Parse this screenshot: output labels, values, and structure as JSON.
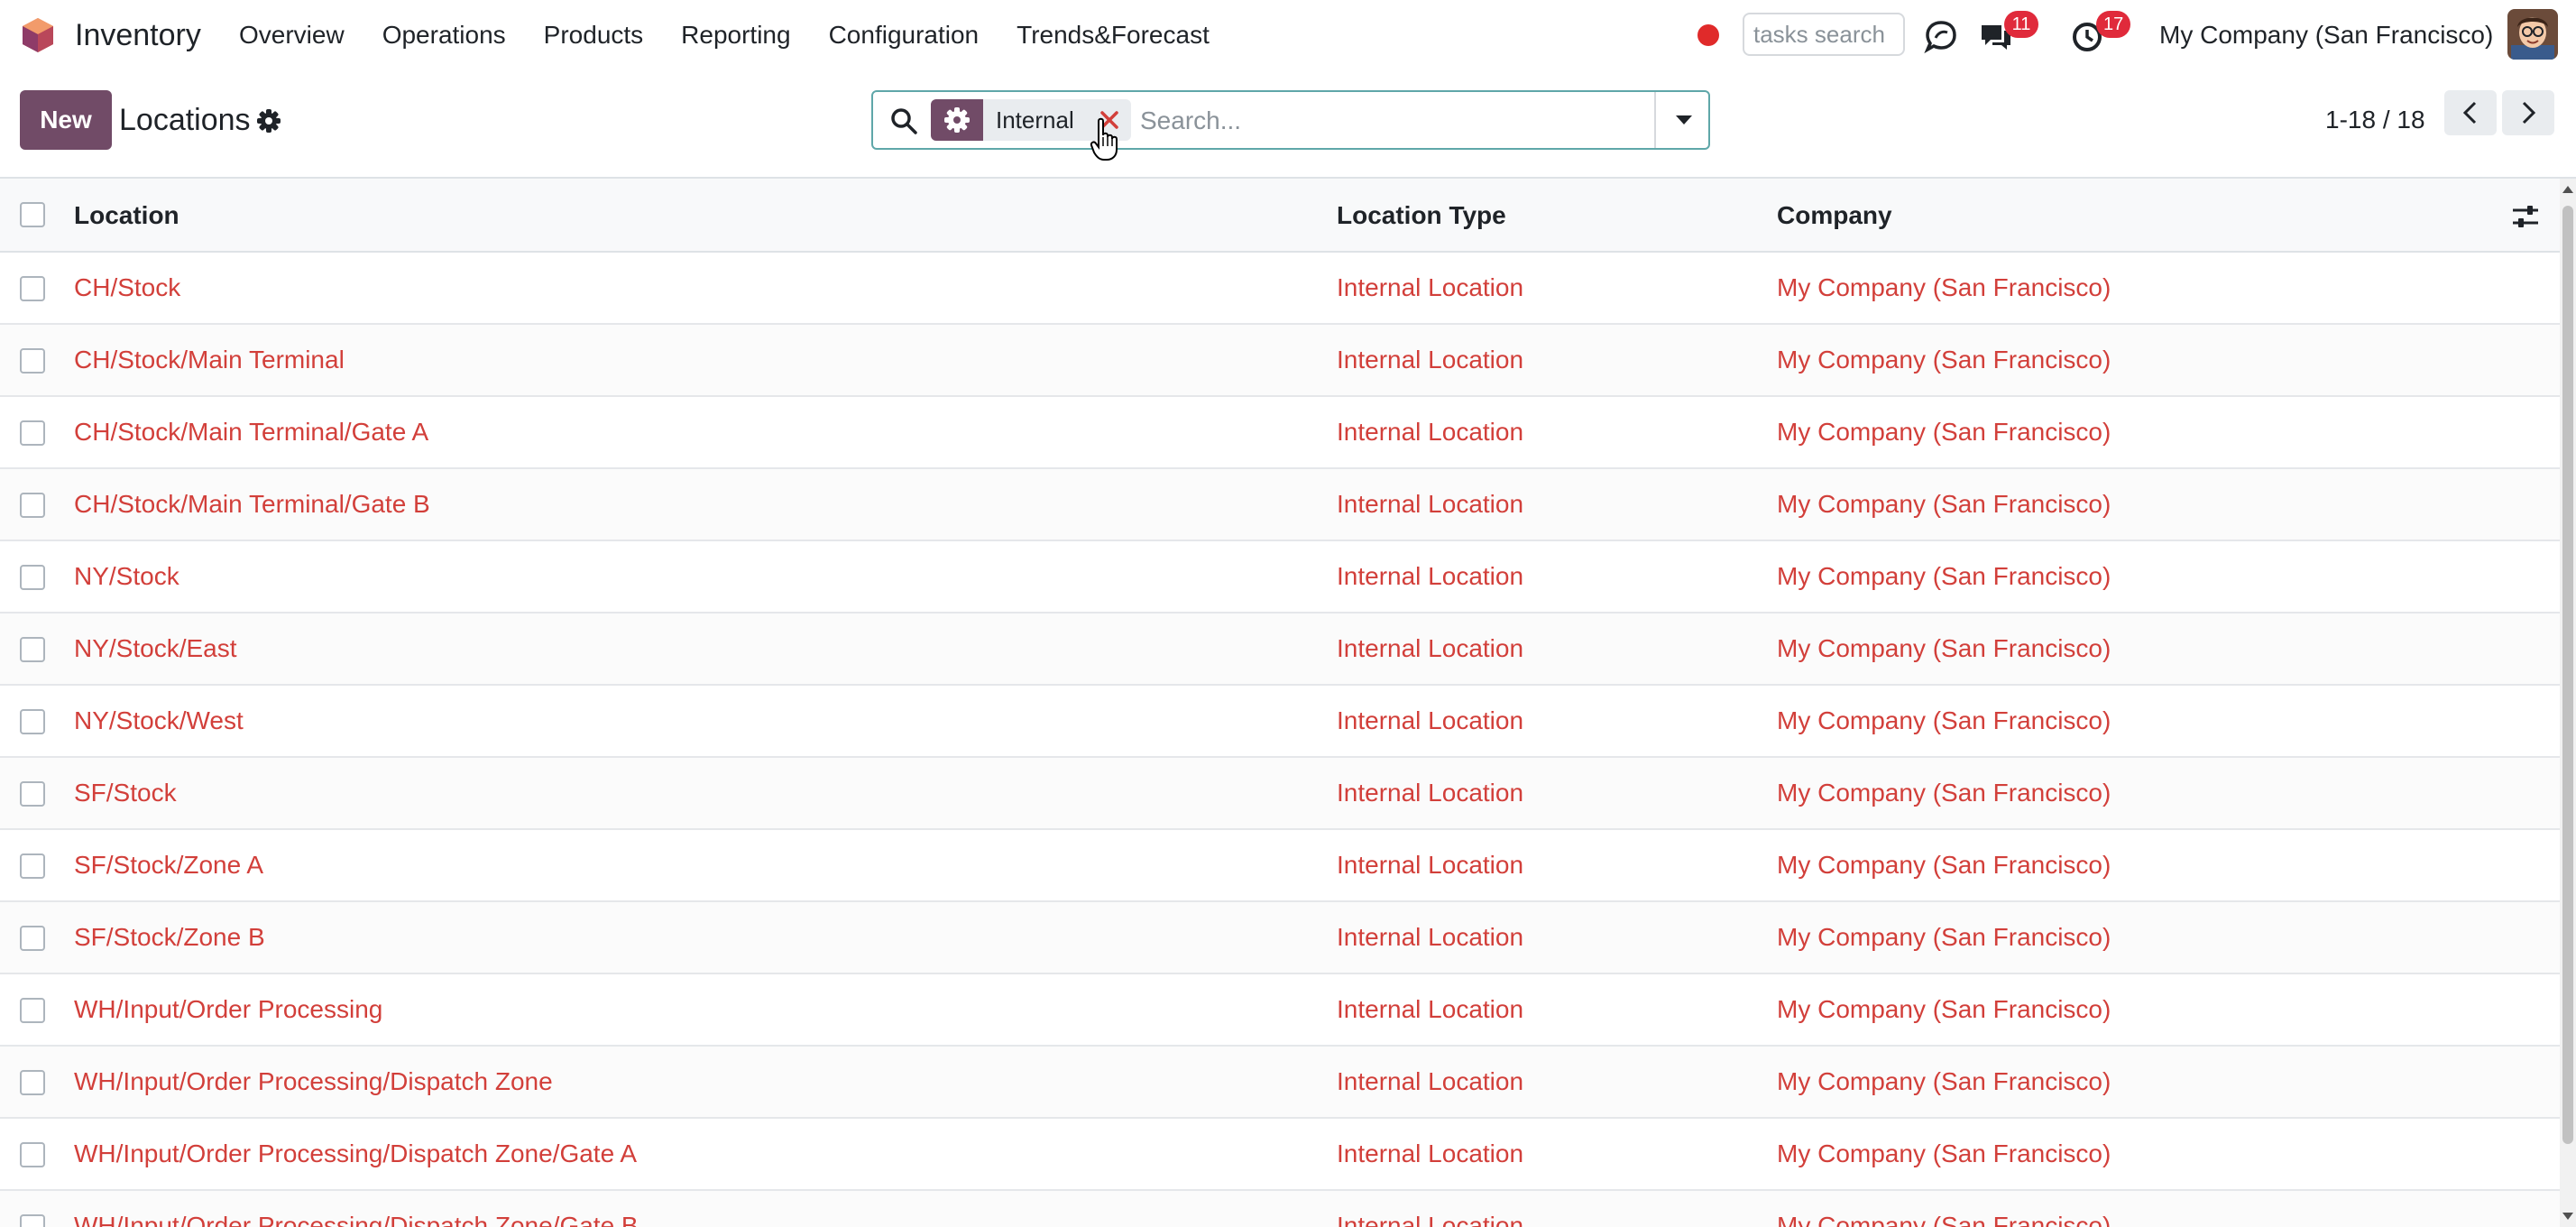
{
  "navbar": {
    "app_name": "Inventory",
    "menu": [
      "Overview",
      "Operations",
      "Products",
      "Reporting",
      "Configuration",
      "Trends&Forecast"
    ],
    "tasks_search_placeholder": "tasks search",
    "messages_badge": "11",
    "activities_badge": "17",
    "company": "My Company (San Francisco)"
  },
  "control_panel": {
    "new_label": "New",
    "title": "Locations",
    "search": {
      "facet_label": "Internal",
      "placeholder": "Search..."
    },
    "pager": "1-18 / 18"
  },
  "list": {
    "columns": [
      "Location",
      "Location Type",
      "Company"
    ],
    "rows": [
      {
        "location": "CH/Stock",
        "type": "Internal Location",
        "company": "My Company (San Francisco)"
      },
      {
        "location": "CH/Stock/Main Terminal",
        "type": "Internal Location",
        "company": "My Company (San Francisco)"
      },
      {
        "location": "CH/Stock/Main Terminal/Gate A",
        "type": "Internal Location",
        "company": "My Company (San Francisco)"
      },
      {
        "location": "CH/Stock/Main Terminal/Gate B",
        "type": "Internal Location",
        "company": "My Company (San Francisco)"
      },
      {
        "location": "NY/Stock",
        "type": "Internal Location",
        "company": "My Company (San Francisco)"
      },
      {
        "location": "NY/Stock/East",
        "type": "Internal Location",
        "company": "My Company (San Francisco)"
      },
      {
        "location": "NY/Stock/West",
        "type": "Internal Location",
        "company": "My Company (San Francisco)"
      },
      {
        "location": "SF/Stock",
        "type": "Internal Location",
        "company": "My Company (San Francisco)"
      },
      {
        "location": "SF/Stock/Zone A",
        "type": "Internal Location",
        "company": "My Company (San Francisco)"
      },
      {
        "location": "SF/Stock/Zone B",
        "type": "Internal Location",
        "company": "My Company (San Francisco)"
      },
      {
        "location": "WH/Input/Order Processing",
        "type": "Internal Location",
        "company": "My Company (San Francisco)"
      },
      {
        "location": "WH/Input/Order Processing/Dispatch Zone",
        "type": "Internal Location",
        "company": "My Company (San Francisco)"
      },
      {
        "location": "WH/Input/Order Processing/Dispatch Zone/Gate A",
        "type": "Internal Location",
        "company": "My Company (San Francisco)"
      },
      {
        "location": "WH/Input/Order Processing/Dispatch Zone/Gate B",
        "type": "Internal Location",
        "company": "My Company (San Francisco)"
      }
    ]
  },
  "icons": {
    "app_logo": "odoo-inventory-logo-icon",
    "recording": "record-dot-icon",
    "discuss": "chat-bubble-icon",
    "messages": "messages-icon",
    "activities": "clock-icon",
    "title_settings": "gear-icon",
    "search": "search-icon",
    "facet": "gear-icon",
    "facet_remove": "close-icon",
    "search_options": "caret-down-icon",
    "pager_prev": "chevron-left-icon",
    "pager_next": "chevron-right-icon",
    "optional_columns": "sliders-icon"
  },
  "colors": {
    "brand": "#714b67",
    "link": "#d23f3a",
    "badge": "#e02a3b",
    "recording": "#e02a2a",
    "search_border": "#5fa7a9"
  }
}
